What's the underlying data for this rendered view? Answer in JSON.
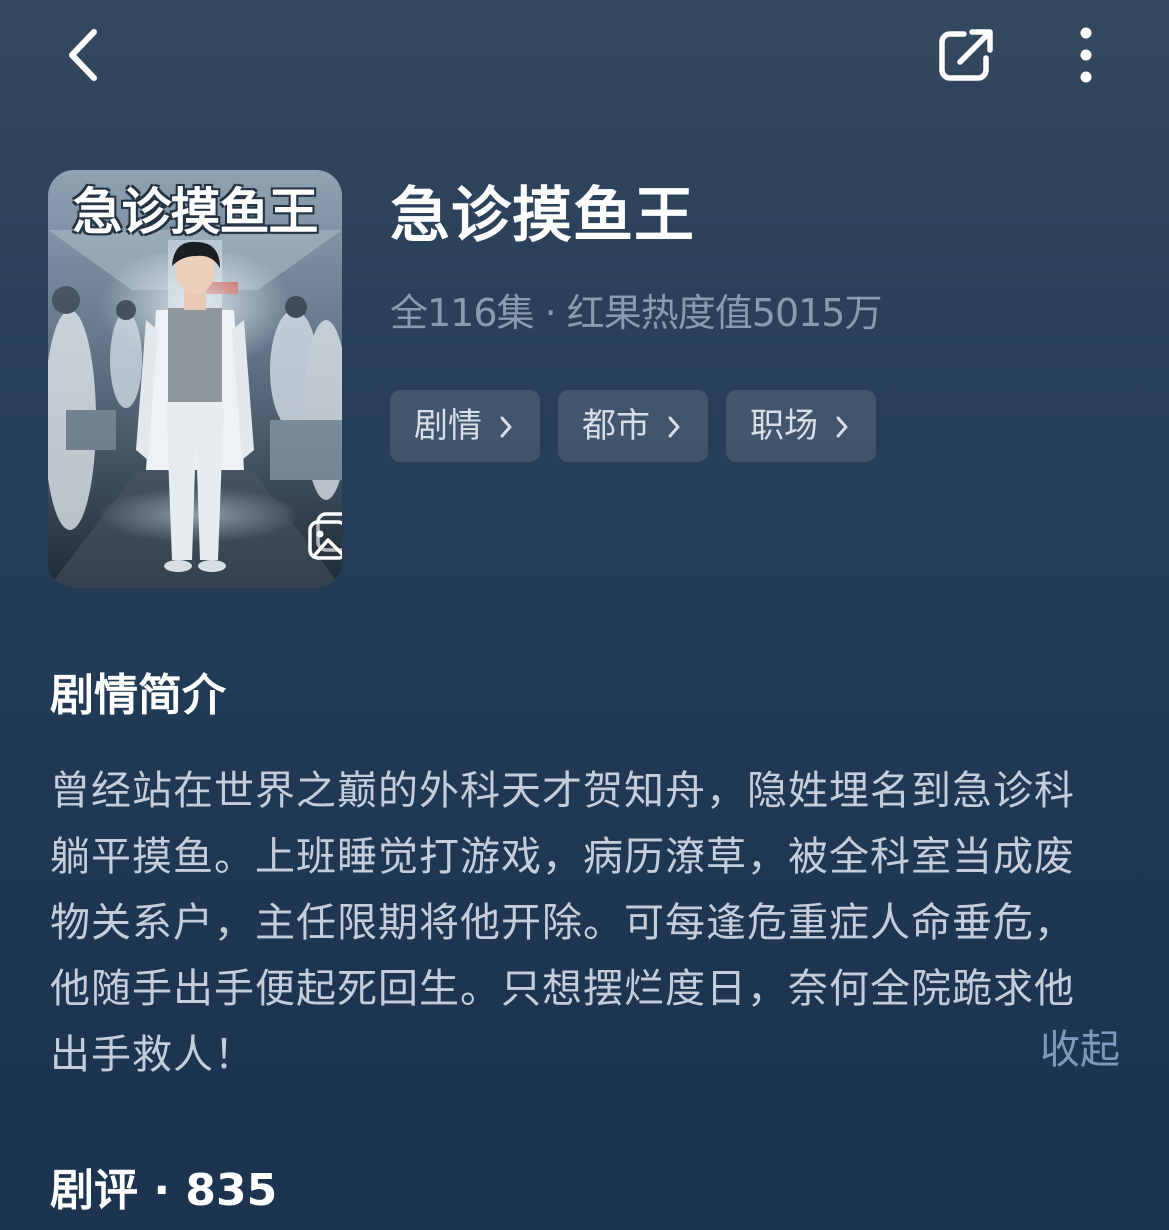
{
  "header": {
    "back_icon": "back-arrow-icon",
    "share_icon": "share-icon",
    "more_icon": "more-vertical-icon"
  },
  "show": {
    "poster_title": "急诊摸鱼王",
    "poster_icon": "gallery-icon",
    "title": "急诊摸鱼王",
    "meta": "全116集 · 红果热度值5015万",
    "tags": [
      {
        "label": "剧情"
      },
      {
        "label": "都市"
      },
      {
        "label": "职场"
      }
    ]
  },
  "synopsis": {
    "heading": "剧情简介",
    "lines": [
      "曾经站在世界之巅的外科天才贺知舟，隐姓埋名到急诊科",
      "躺平摸鱼。上班睡觉打游戏，病历潦草，被全科室当成废",
      "物关系户，主任限期将他开除。可每逢危重症人命垂危，",
      "他随手出手便起死回生。只想摆烂度日，奈何全院跪求他",
      "出手救人！"
    ],
    "collapse_label": "收起"
  },
  "reviews": {
    "heading": "剧评 · 835"
  },
  "colors": {
    "background_top": "#34495f",
    "background_bottom": "#1c3450",
    "meta_text": "#8a9ab0",
    "link_text": "#7e99bd"
  }
}
